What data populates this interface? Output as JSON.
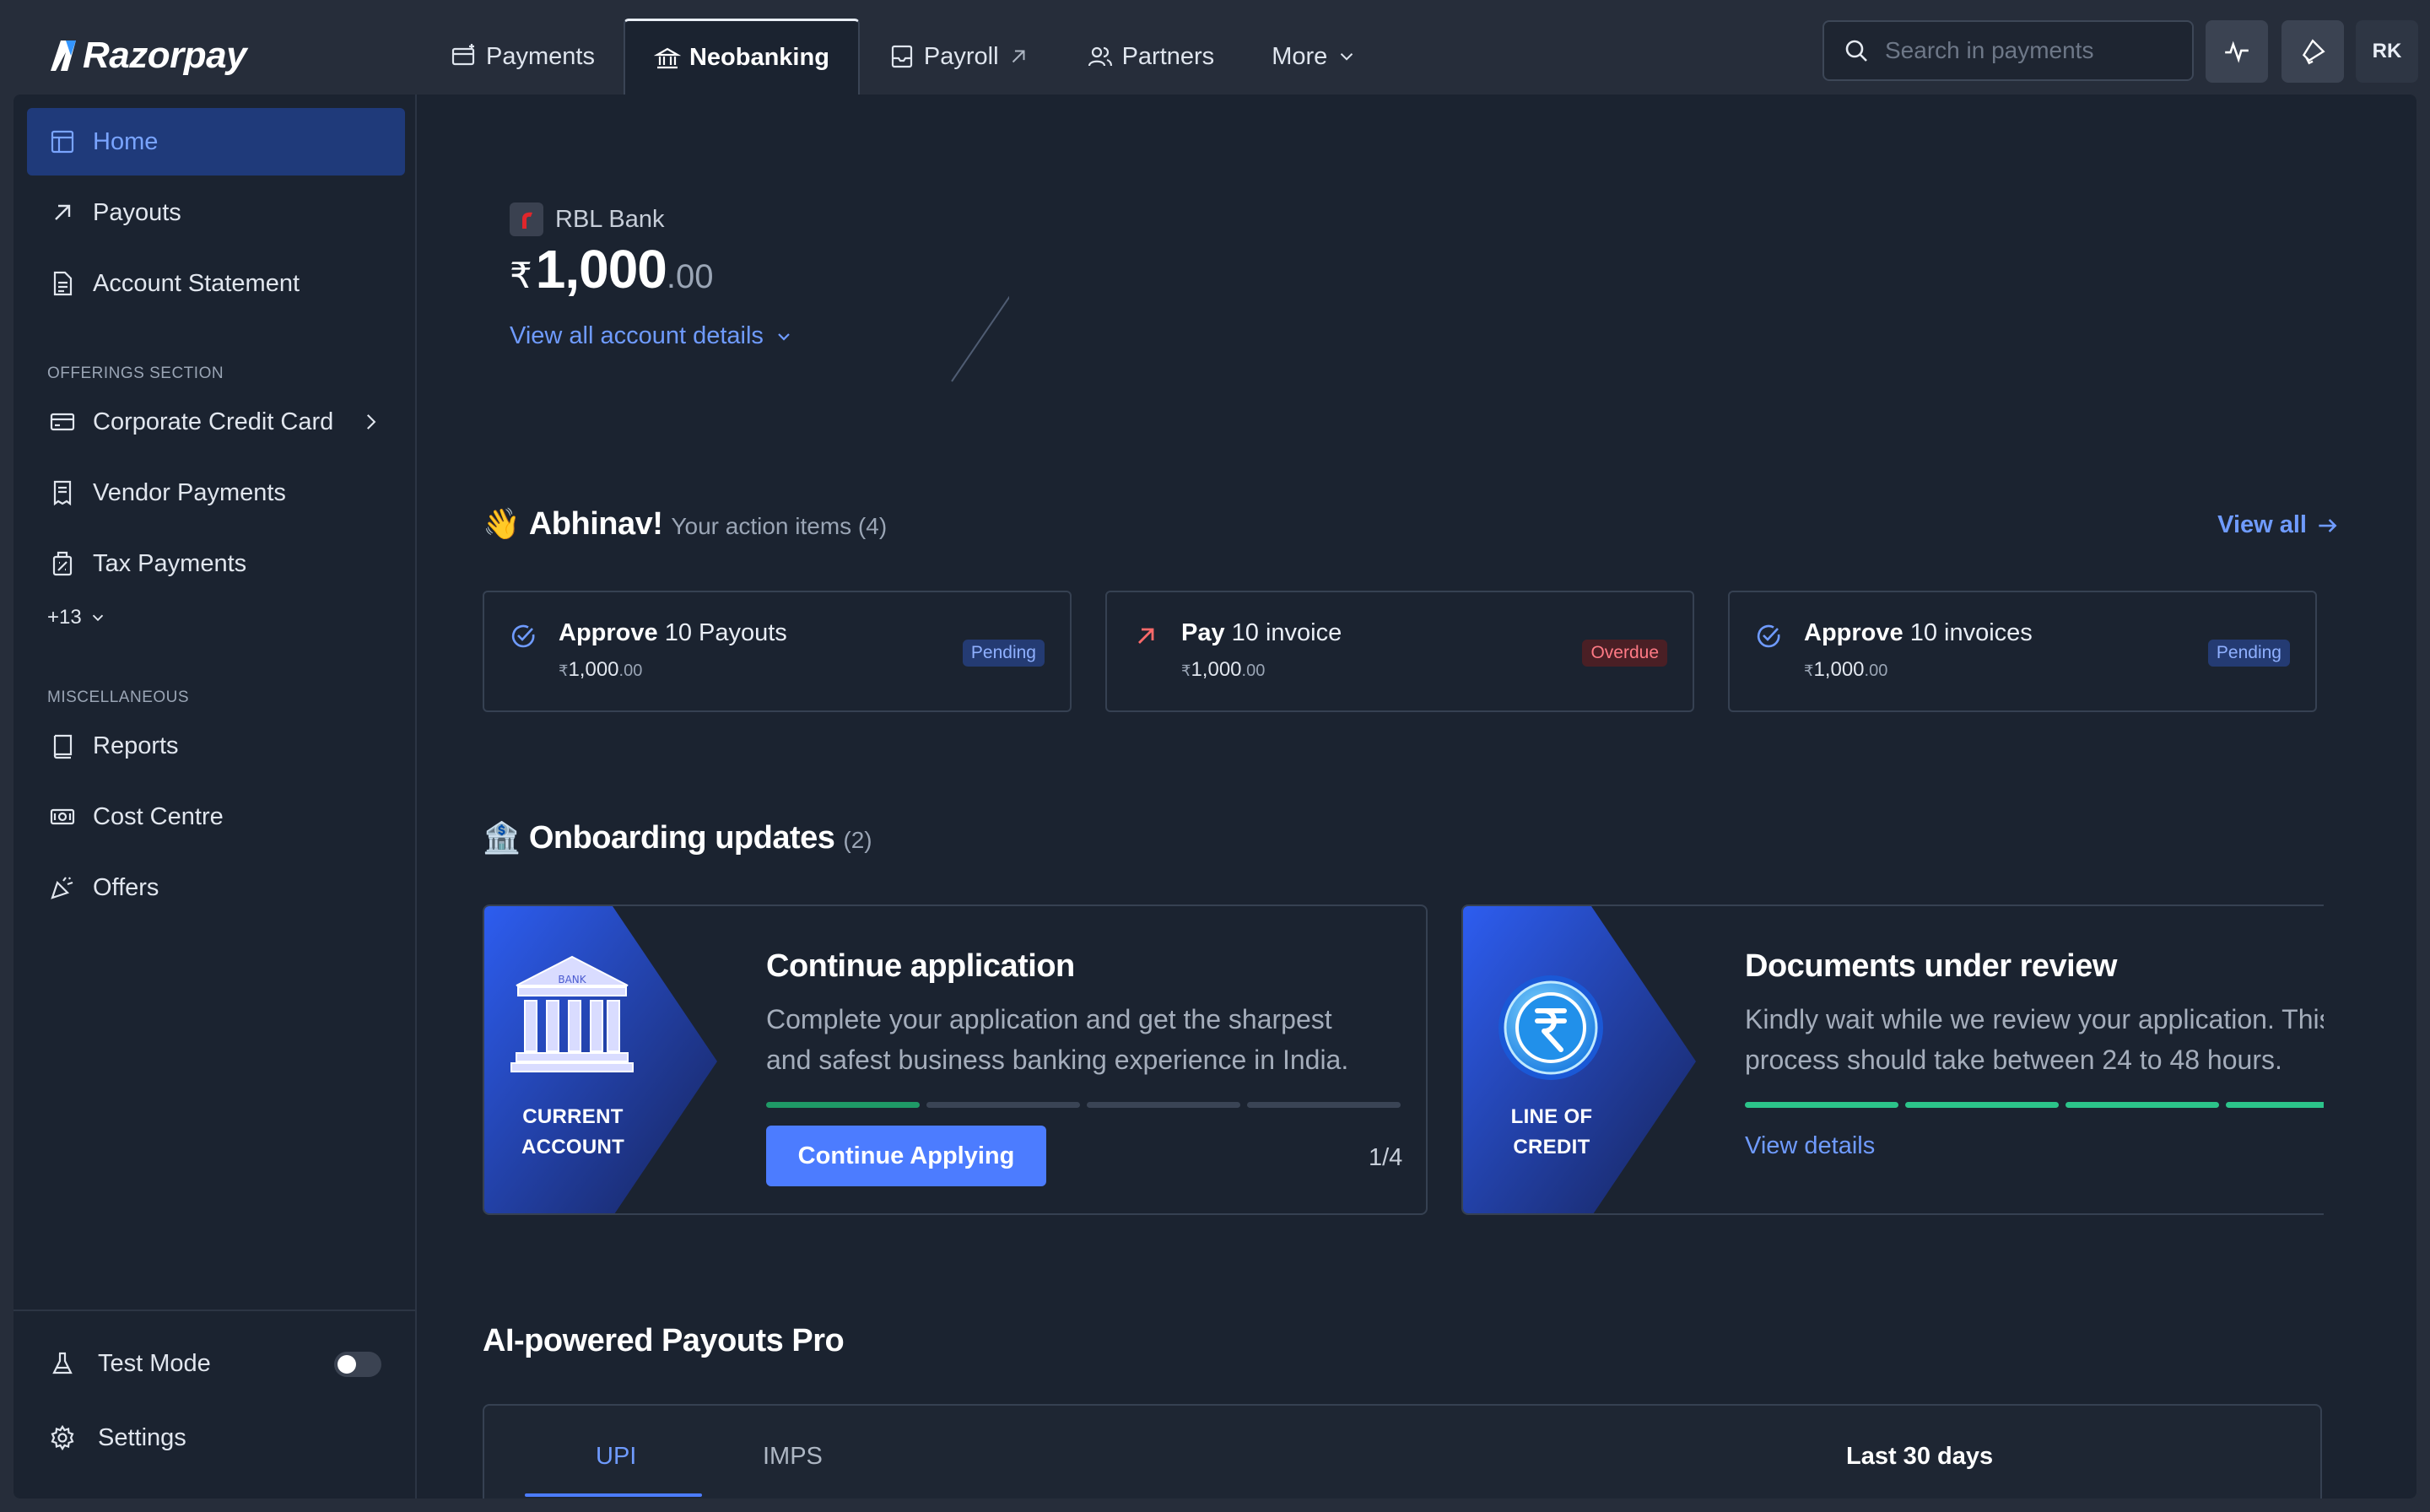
{
  "app": {
    "brand": "Razorpay"
  },
  "nav": {
    "tabs": [
      {
        "label": "Payments"
      },
      {
        "label": "Neobanking"
      },
      {
        "label": "Payroll"
      },
      {
        "label": "Partners"
      },
      {
        "label": "More"
      }
    ]
  },
  "search": {
    "placeholder": "Search in payments"
  },
  "user": {
    "initials": "RK"
  },
  "sidebar": {
    "items": [
      {
        "label": "Home"
      },
      {
        "label": "Payouts"
      },
      {
        "label": "Account Statement"
      },
      {
        "label": "Corporate Credit Card"
      },
      {
        "label": "Vendor Payments"
      },
      {
        "label": "Tax Payments"
      },
      {
        "label": "Reports"
      },
      {
        "label": "Cost Centre"
      },
      {
        "label": "Offers"
      }
    ],
    "sections": {
      "offerings": "OFFERINGS SECTION",
      "misc": "MISCELLANEOUS"
    },
    "more_label": "+13",
    "footer": {
      "test_mode": "Test Mode",
      "settings": "Settings"
    }
  },
  "account": {
    "bank": "RBL Bank",
    "currency": "₹",
    "balance_main": "1,000",
    "balance_decimal": ".00",
    "details_link": "View all account details"
  },
  "actions": {
    "greeting_emoji": "👋",
    "greeting": "Abhinav!",
    "subtitle": "Your action items (4)",
    "view_all": "View all",
    "items": [
      {
        "verb": "Approve",
        "rest": " 10 Payouts",
        "currency": "₹",
        "amount": "1,000",
        "decimal": ".00",
        "status": "Pending"
      },
      {
        "verb": "Pay",
        "rest": " 10 invoice",
        "currency": "₹",
        "amount": "1,000",
        "decimal": ".00",
        "status": "Overdue"
      },
      {
        "verb": "Approve",
        "rest": " 10 invoices",
        "currency": "₹",
        "amount": "1,000",
        "decimal": ".00",
        "status": "Pending"
      }
    ]
  },
  "onboarding": {
    "emoji": "🏦",
    "title": "Onboarding updates",
    "count": "(2)",
    "cards": [
      {
        "art_label_1": "CURRENT",
        "art_label_2": "ACCOUNT",
        "title": "Continue application",
        "desc_1": "Complete your application and get the sharpest",
        "desc_2": "and safest business banking experience in India.",
        "cta": "Continue Applying",
        "step": "1/4",
        "progress_done": 1,
        "progress_total": 4
      },
      {
        "art_label_1": "LINE OF",
        "art_label_2": "CREDIT",
        "title": "Documents under review",
        "desc_1": "Kindly wait while we review your application. This",
        "desc_2": "process should take between 24 to 48 hours.",
        "link": "View details",
        "progress_done": 4,
        "progress_total": 4
      }
    ]
  },
  "payouts": {
    "title": "AI-powered Payouts Pro",
    "tabs": [
      "UPI",
      "IMPS"
    ],
    "period": "Last 30 days"
  },
  "colors": {
    "accent": "#4c7cff",
    "link": "#6f9bff",
    "success": "#2cc48a",
    "danger": "#ff7a85",
    "background": "#1b2330"
  }
}
